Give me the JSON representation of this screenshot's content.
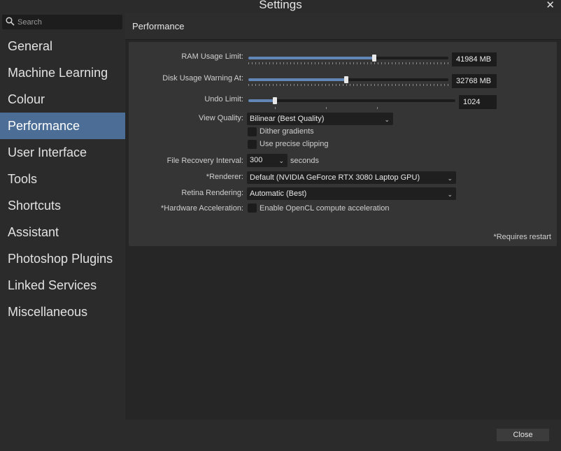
{
  "window": {
    "title": "Settings",
    "close_glyph": "✕"
  },
  "search": {
    "placeholder": "Search",
    "icon": "search-icon"
  },
  "sidebar": {
    "items": [
      {
        "label": "General"
      },
      {
        "label": "Machine Learning"
      },
      {
        "label": "Colour"
      },
      {
        "label": "Performance",
        "active": true
      },
      {
        "label": "User Interface"
      },
      {
        "label": "Tools"
      },
      {
        "label": "Shortcuts"
      },
      {
        "label": "Assistant"
      },
      {
        "label": "Photoshop Plugins"
      },
      {
        "label": "Linked Services"
      },
      {
        "label": "Miscellaneous"
      }
    ]
  },
  "section": {
    "title": "Performance"
  },
  "performance": {
    "ram": {
      "label": "RAM Usage Limit:",
      "value": "41984 MB",
      "level": 0.63
    },
    "disk": {
      "label": "Disk Usage Warning At:",
      "value": "32768 MB",
      "level": 0.49
    },
    "undo": {
      "label": "Undo Limit:",
      "value": "1024",
      "level": 0.13
    },
    "view_quality": {
      "label": "View Quality:",
      "value": "Bilinear (Best Quality)"
    },
    "dither": {
      "label": "Dither gradients",
      "checked": false
    },
    "precise_clipping": {
      "label": "Use precise clipping",
      "checked": false
    },
    "file_recovery": {
      "label": "File Recovery Interval:",
      "value": "300",
      "unit": "seconds"
    },
    "renderer": {
      "label": "*Renderer:",
      "value": "Default (NVIDIA GeForce RTX 3080 Laptop GPU)"
    },
    "retina": {
      "label": "Retina Rendering:",
      "value": "Automatic (Best)"
    },
    "hw_accel": {
      "label": "*Hardware Acceleration:",
      "option_label": "Enable OpenCL compute acceleration",
      "checked": false
    },
    "restart_note": "*Requires restart"
  },
  "footer": {
    "close_label": "Close"
  },
  "colors": {
    "accent": "#4c6e96",
    "slider_fill": "#6286b6",
    "background": "#2b2b2b",
    "panel": "#353535"
  }
}
